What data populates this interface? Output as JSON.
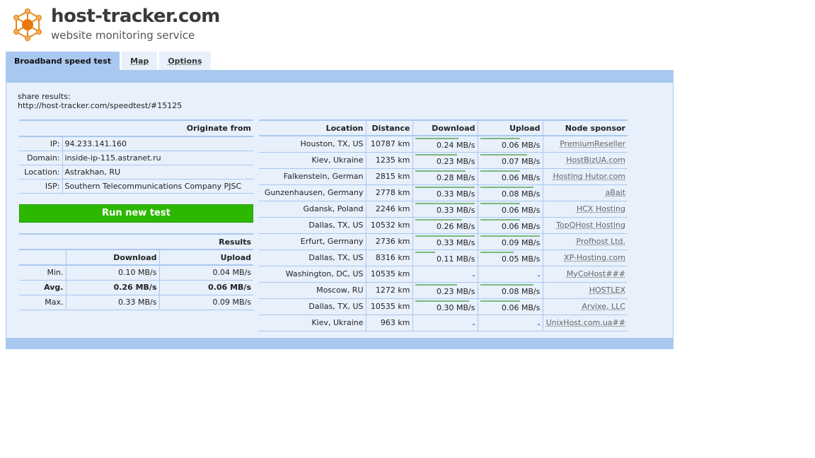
{
  "brand": {
    "title": "host-tracker.com",
    "tagline": "website monitoring service"
  },
  "tabs": [
    {
      "label": "Broadband speed test",
      "active": true
    },
    {
      "label": "Map",
      "active": false
    },
    {
      "label": "Options",
      "active": false
    }
  ],
  "share": {
    "label": "share results:",
    "url": "http://host-tracker.com/speedtest/#15125"
  },
  "origin": {
    "header": "Originate from",
    "rows": [
      {
        "key": "IP:",
        "value": "94.233.141.160"
      },
      {
        "key": "Domain:",
        "value": "inside-ip-115.astranet.ru"
      },
      {
        "key": "Location:",
        "value": "Astrakhan, RU"
      },
      {
        "key": "ISP:",
        "value": "Southern Telecommunications Company PJSC"
      }
    ]
  },
  "run_button": "Run new test",
  "results": {
    "title": "Results",
    "col_download": "Download",
    "col_upload": "Upload",
    "rows": [
      {
        "label": "Min.",
        "download": "0.10 MB/s",
        "upload": "0.04 MB/s",
        "bold": false
      },
      {
        "label": "Avg.",
        "download": "0.26 MB/s",
        "upload": "0.06 MB/s",
        "bold": true
      },
      {
        "label": "Max.",
        "download": "0.33 MB/s",
        "upload": "0.09 MB/s",
        "bold": false
      }
    ]
  },
  "speed_table": {
    "headers": {
      "location": "Location",
      "distance": "Distance",
      "download": "Download",
      "upload": "Upload",
      "sponsor": "Node sponsor"
    },
    "bar_color": "#7cb97c",
    "rows": [
      {
        "location": "Houston, TX, US",
        "distance": "10787 km",
        "download": "0.24 MB/s",
        "download_fill": 0.73,
        "upload": "0.06 MB/s",
        "upload_fill": 0.67,
        "sponsor": "PremiumReseller"
      },
      {
        "location": "Kiev, Ukraine",
        "distance": "1235 km",
        "download": "0.23 MB/s",
        "download_fill": 0.7,
        "upload": "0.07 MB/s",
        "upload_fill": 0.78,
        "sponsor": "HostBizUA.com"
      },
      {
        "location": "Falkenstein, German",
        "distance": "2815 km",
        "download": "0.28 MB/s",
        "download_fill": 0.85,
        "upload": "0.06 MB/s",
        "upload_fill": 0.67,
        "sponsor": "Hosting Hutor.com"
      },
      {
        "location": "Gunzenhausen, Germany",
        "distance": "2778 km",
        "download": "0.33 MB/s",
        "download_fill": 1.0,
        "upload": "0.08 MB/s",
        "upload_fill": 0.89,
        "sponsor": "aBajt"
      },
      {
        "location": "Gdansk, Poland",
        "distance": "2246 km",
        "download": "0.33 MB/s",
        "download_fill": 1.0,
        "upload": "0.06 MB/s",
        "upload_fill": 0.67,
        "sponsor": "HCX Hosting"
      },
      {
        "location": "Dallas, TX, US",
        "distance": "10532 km",
        "download": "0.26 MB/s",
        "download_fill": 0.79,
        "upload": "0.06 MB/s",
        "upload_fill": 0.67,
        "sponsor": "TopQHost Hosting"
      },
      {
        "location": "Erfurt, Germany",
        "distance": "2736 km",
        "download": "0.33 MB/s",
        "download_fill": 1.0,
        "upload": "0.09 MB/s",
        "upload_fill": 1.0,
        "sponsor": "Profhost Ltd."
      },
      {
        "location": "Dallas, TX, US",
        "distance": "8316 km",
        "download": "0.11 MB/s",
        "download_fill": 0.33,
        "upload": "0.05 MB/s",
        "upload_fill": 0.56,
        "sponsor": "XP-Hosting.com"
      },
      {
        "location": "Washington, DC, US",
        "distance": "10535 km",
        "download": "-",
        "download_fill": 0,
        "upload": "-",
        "upload_fill": 0,
        "sponsor": "MyCoHost###"
      },
      {
        "location": "Moscow, RU",
        "distance": "1272 km",
        "download": "0.23 MB/s",
        "download_fill": 0.7,
        "upload": "0.08 MB/s",
        "upload_fill": 0.89,
        "sponsor": "HOSTLEX"
      },
      {
        "location": "Dallas, TX, US",
        "distance": "10535 km",
        "download": "0.30 MB/s",
        "download_fill": 0.91,
        "upload": "0.06 MB/s",
        "upload_fill": 0.67,
        "sponsor": "Arvixe, LLC"
      },
      {
        "location": "Kiev, Ukraine",
        "distance": "963 km",
        "download": "-",
        "download_fill": 0,
        "upload": "-",
        "upload_fill": 0,
        "sponsor": "UnixHost.com.ua##"
      }
    ]
  }
}
